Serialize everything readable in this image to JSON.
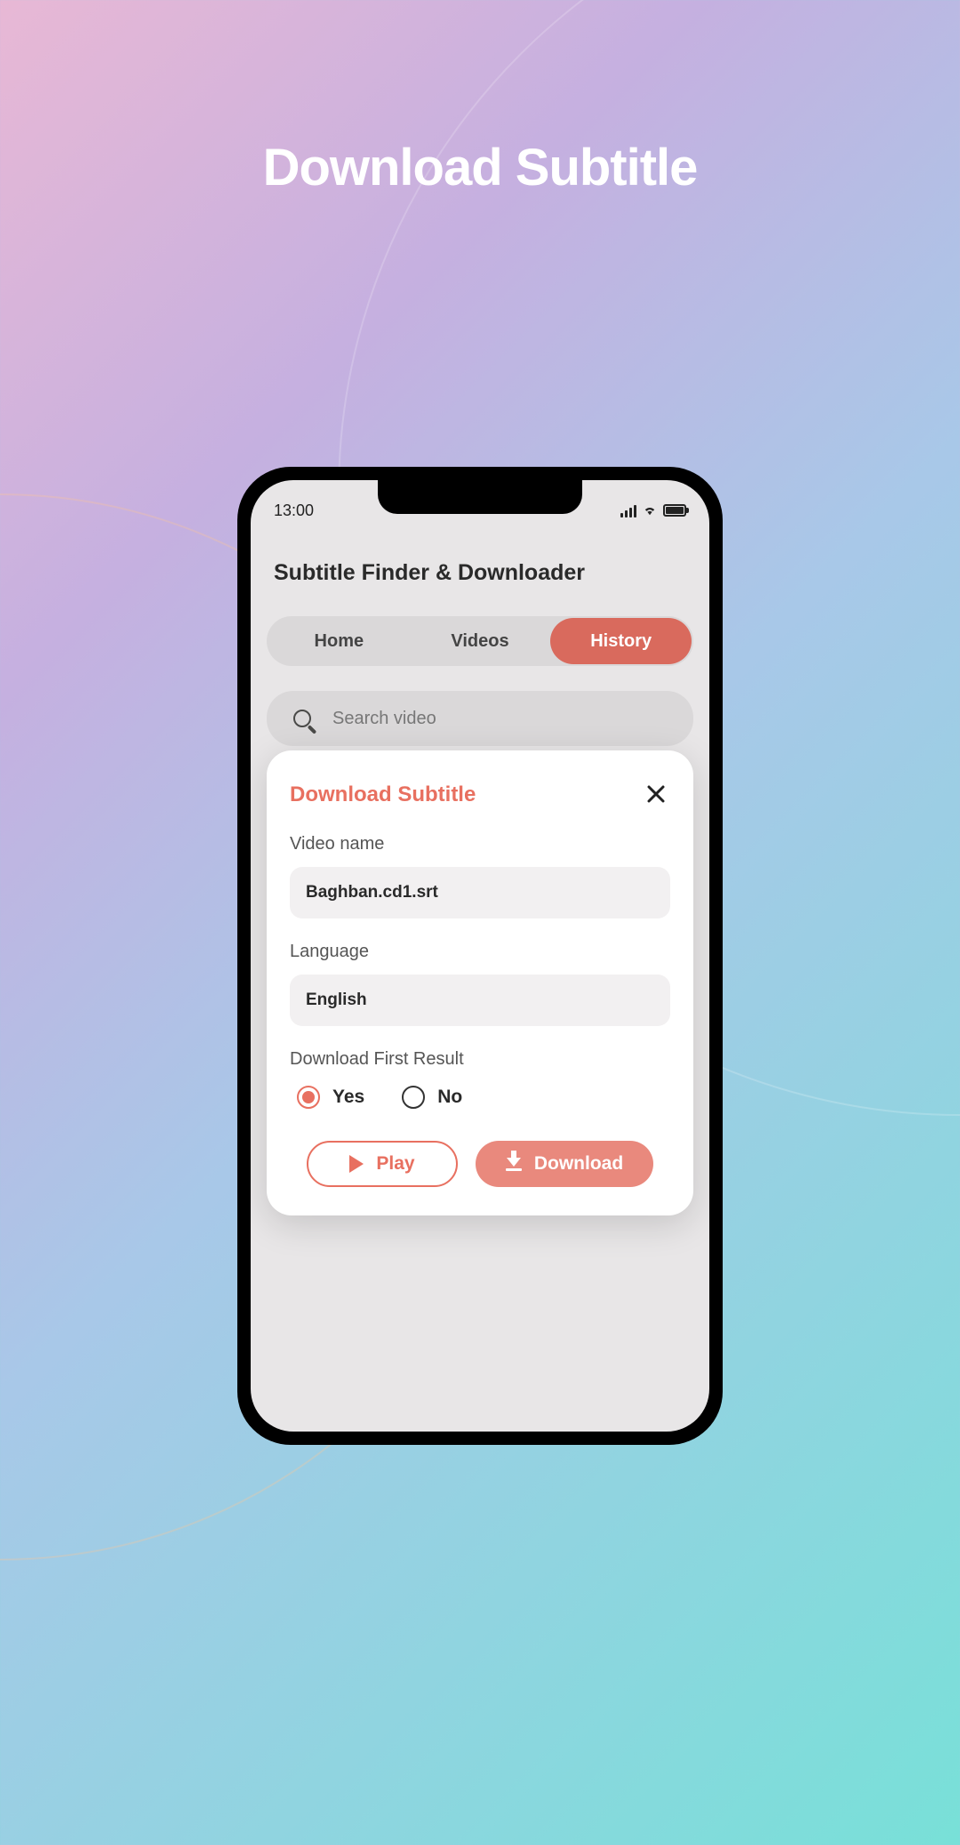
{
  "page": {
    "title": "Download Subtitle"
  },
  "phone": {
    "status": {
      "time": "13:00"
    },
    "app": {
      "title": "Subtitle Finder & Downloader"
    },
    "tabs": {
      "home": "Home",
      "videos": "Videos",
      "history": "History"
    },
    "search": {
      "placeholder": "Search video"
    },
    "modal": {
      "title": "Download Subtitle",
      "video_name_label": "Video name",
      "video_name_value": "Baghban.cd1.srt",
      "language_label": "Language",
      "language_value": "English",
      "download_first_label": "Download First Result",
      "yes_label": "Yes",
      "no_label": "No",
      "play_label": "Play",
      "download_label": "Download"
    }
  },
  "colors": {
    "accent": "#e87060"
  }
}
